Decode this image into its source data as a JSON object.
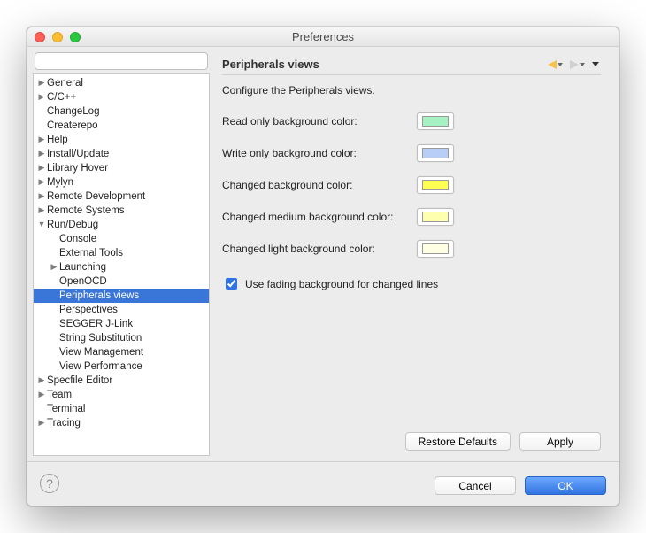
{
  "window": {
    "title": "Preferences"
  },
  "search": {
    "value": "",
    "placeholder": ""
  },
  "tree": [
    {
      "label": "General",
      "depth": 0,
      "arrow": "right"
    },
    {
      "label": "C/C++",
      "depth": 0,
      "arrow": "right"
    },
    {
      "label": "ChangeLog",
      "depth": 0,
      "arrow": "none"
    },
    {
      "label": "Createrepo",
      "depth": 0,
      "arrow": "none"
    },
    {
      "label": "Help",
      "depth": 0,
      "arrow": "right"
    },
    {
      "label": "Install/Update",
      "depth": 0,
      "arrow": "right"
    },
    {
      "label": "Library Hover",
      "depth": 0,
      "arrow": "right"
    },
    {
      "label": "Mylyn",
      "depth": 0,
      "arrow": "right"
    },
    {
      "label": "Remote Development",
      "depth": 0,
      "arrow": "right"
    },
    {
      "label": "Remote Systems",
      "depth": 0,
      "arrow": "right"
    },
    {
      "label": "Run/Debug",
      "depth": 0,
      "arrow": "down"
    },
    {
      "label": "Console",
      "depth": 1,
      "arrow": "none"
    },
    {
      "label": "External Tools",
      "depth": 1,
      "arrow": "none"
    },
    {
      "label": "Launching",
      "depth": 1,
      "arrow": "right"
    },
    {
      "label": "OpenOCD",
      "depth": 1,
      "arrow": "none"
    },
    {
      "label": "Peripherals views",
      "depth": 1,
      "arrow": "none",
      "selected": true
    },
    {
      "label": "Perspectives",
      "depth": 1,
      "arrow": "none"
    },
    {
      "label": "SEGGER J-Link",
      "depth": 1,
      "arrow": "none"
    },
    {
      "label": "String Substitution",
      "depth": 1,
      "arrow": "none"
    },
    {
      "label": "View Management",
      "depth": 1,
      "arrow": "none"
    },
    {
      "label": "View Performance",
      "depth": 1,
      "arrow": "none"
    },
    {
      "label": "Specfile Editor",
      "depth": 0,
      "arrow": "right"
    },
    {
      "label": "Team",
      "depth": 0,
      "arrow": "right"
    },
    {
      "label": "Terminal",
      "depth": 0,
      "arrow": "none"
    },
    {
      "label": "Tracing",
      "depth": 0,
      "arrow": "right"
    }
  ],
  "panel": {
    "heading": "Peripherals views",
    "description": "Configure the Peripherals views.",
    "rows": [
      {
        "label": "Read only background color:",
        "color": "#A6F2C3"
      },
      {
        "label": "Write only background color:",
        "color": "#B8CEF6"
      },
      {
        "label": "Changed background color:",
        "color": "#FFFF54"
      },
      {
        "label": "Changed medium background color:",
        "color": "#FFFFB0"
      },
      {
        "label": "Changed light background color:",
        "color": "#FFFFE4"
      }
    ],
    "checkbox": {
      "label": "Use fading background for changed lines",
      "checked": true
    }
  },
  "buttons": {
    "restore": "Restore Defaults",
    "apply": "Apply",
    "cancel": "Cancel",
    "ok": "OK"
  }
}
